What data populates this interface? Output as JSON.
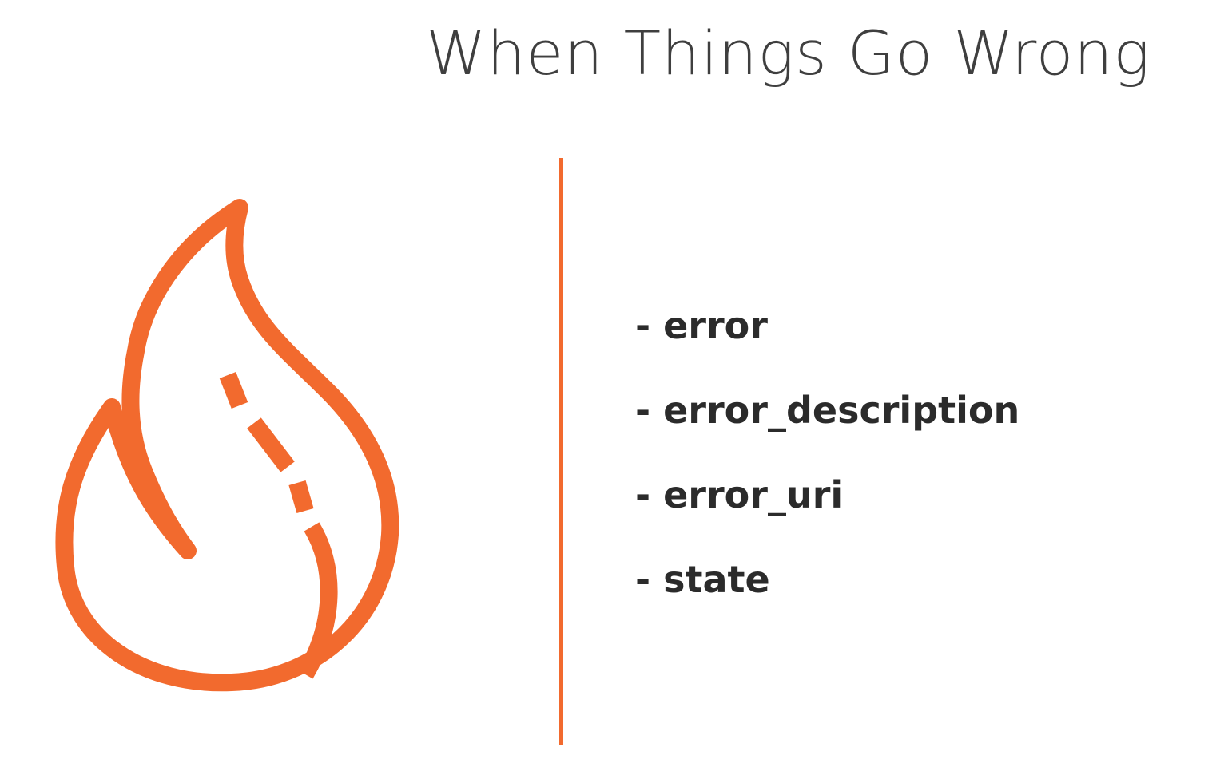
{
  "slide": {
    "title": "When Things Go Wrong",
    "accent_color": "#f26a2e",
    "icon": "flame-icon",
    "bullets": [
      "- error",
      "- error_description",
      "- error_uri",
      "- state"
    ]
  }
}
